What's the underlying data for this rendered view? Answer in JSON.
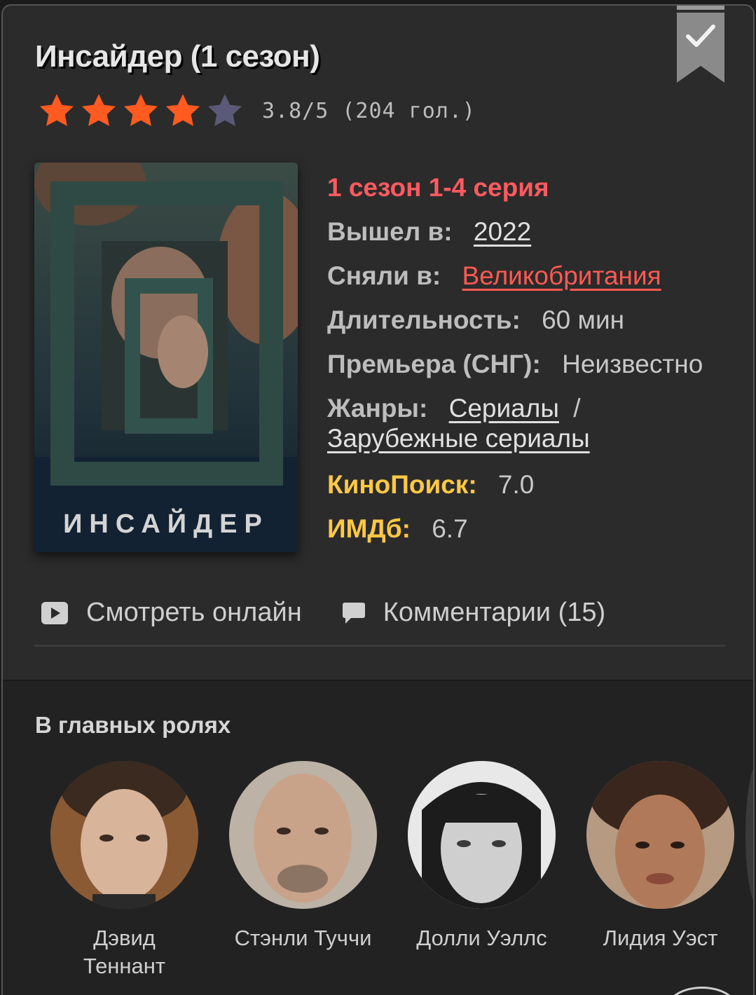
{
  "title": "Инсайдер (1 сезон)",
  "rating": {
    "value": 3.8,
    "max": 5,
    "stars_filled": 4,
    "text": "3.8/5 (204 гол.)",
    "star_color": "#ff5a1f"
  },
  "poster": {
    "caption": "ИНСАЙДЕР"
  },
  "info": {
    "episodes": "1 сезон 1-4 серия",
    "released_label": "Вышел в:",
    "released_value": "2022",
    "country_label": "Сняли в:",
    "country_value": "Великобритания",
    "duration_label": "Длительность:",
    "duration_value": "60 мин",
    "premiere_label": "Премьера (СНГ):",
    "premiere_value": "Неизвестно",
    "genres_label": "Жанры:",
    "genres": [
      "Сериалы",
      "Зарубежные сериалы"
    ],
    "genre_separator": "/",
    "kinopoisk_label": "КиноПоиск:",
    "kinopoisk_value": "7.0",
    "imdb_label": "ИМДб:",
    "imdb_value": "6.7"
  },
  "actions": {
    "watch": {
      "icon": "play-icon",
      "label": "Смотреть онлайн"
    },
    "comments": {
      "icon": "comment-icon",
      "label": "Комментарии (15)"
    }
  },
  "cast": {
    "title": "В главных ролях",
    "actors": [
      {
        "name": "Дэвид Теннант"
      },
      {
        "name": "Стэнли Туччи"
      },
      {
        "name": "Долли Уэллс"
      },
      {
        "name": "Лидия Уэст"
      }
    ]
  },
  "colors": {
    "accent_red": "#ff5a5f",
    "gold": "#ffc845",
    "background": "#2b2b2b"
  }
}
